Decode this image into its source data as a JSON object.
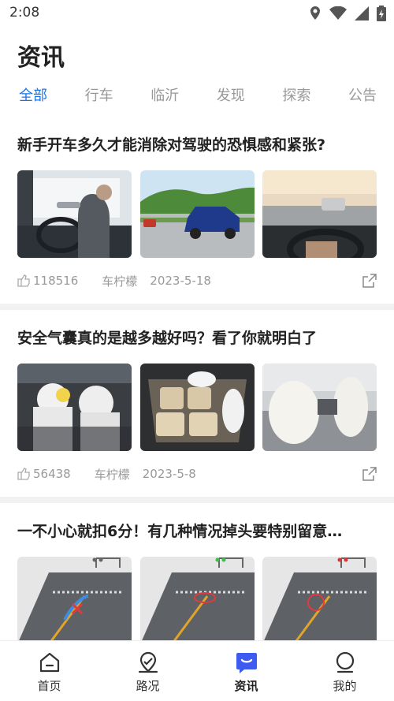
{
  "status": {
    "time": "2:08"
  },
  "header": {
    "title": "资讯"
  },
  "tabs": [
    {
      "label": "全部",
      "active": true
    },
    {
      "label": "行车",
      "active": false
    },
    {
      "label": "临沂",
      "active": false
    },
    {
      "label": "发现",
      "active": false
    },
    {
      "label": "探索",
      "active": false
    },
    {
      "label": "公告",
      "active": false
    }
  ],
  "articles": [
    {
      "title": "新手开车多久才能消除对驾驶的恐惧感和紧张?",
      "views": "118516",
      "author": "车柠檬",
      "date": "2023-5-18"
    },
    {
      "title": "安全气囊真的是越多越好吗？看了你就明白了",
      "views": "56438",
      "author": "车柠檬",
      "date": "2023-5-8"
    },
    {
      "title": "一不小心就扣6分！有几种情况掉头要特别留意…"
    }
  ],
  "bottom_nav": [
    {
      "label": "首页",
      "icon": "home-icon"
    },
    {
      "label": "路况",
      "icon": "location-icon"
    },
    {
      "label": "资讯",
      "icon": "news-icon",
      "active": true
    },
    {
      "label": "我的",
      "icon": "profile-icon"
    }
  ],
  "colors": {
    "accent": "#1a73e8",
    "nav_active": "#3d5af1",
    "muted": "#999999"
  }
}
